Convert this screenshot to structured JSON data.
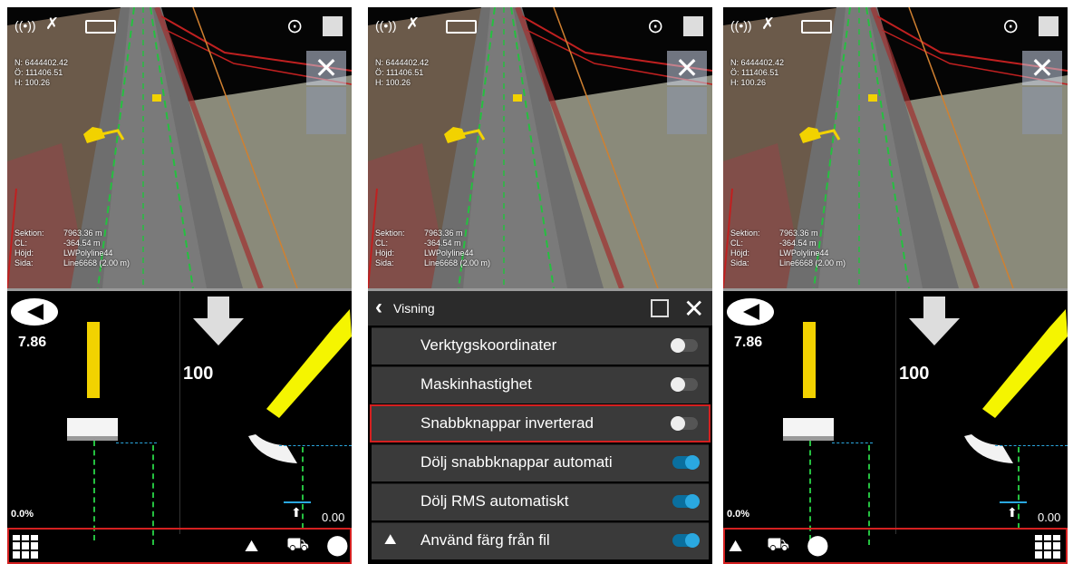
{
  "status": {
    "n_label": "N: 6444402.42",
    "o_label": "Ö: 111406.51",
    "h_label": "H: 100.26"
  },
  "info": {
    "labels": [
      "Sektion:",
      "CL:",
      "Höjd:",
      "Sida:"
    ],
    "values": [
      "7963.36 m",
      "-364.54 m",
      "LWPolyline44",
      "Line6668 (2.00 m)"
    ]
  },
  "readouts": {
    "slope": "7.86",
    "depth": "100",
    "percent": "0.0%",
    "offset": "0.00"
  },
  "menu": {
    "title": "Visning",
    "items": [
      {
        "label": "Verktygskoordinater",
        "state": "off"
      },
      {
        "label": "Maskinhastighet",
        "state": "off"
      },
      {
        "label": "Snabbknappar  inverterad",
        "state": "off"
      },
      {
        "label": "Dölj snabbknappar automati",
        "state": "on"
      },
      {
        "label": "Dölj RMS automatiskt",
        "state": "on"
      },
      {
        "label": "Använd färg från fil",
        "state": "on"
      }
    ]
  },
  "colors": {
    "highlight": "#d42020",
    "toggle_on": "#2aa8e0",
    "blade": "#f2d200",
    "bucket": "#f5f500"
  },
  "icons": [
    "gnss-signal-icon",
    "satellite-icon",
    "battery-icon",
    "locate-icon",
    "cube-view-icon",
    "close-icon",
    "compass-icon",
    "grid-menu-icon",
    "terrain-icon",
    "machine-icon",
    "map-pin-icon",
    "back-chevron-icon",
    "external-window-icon"
  ]
}
